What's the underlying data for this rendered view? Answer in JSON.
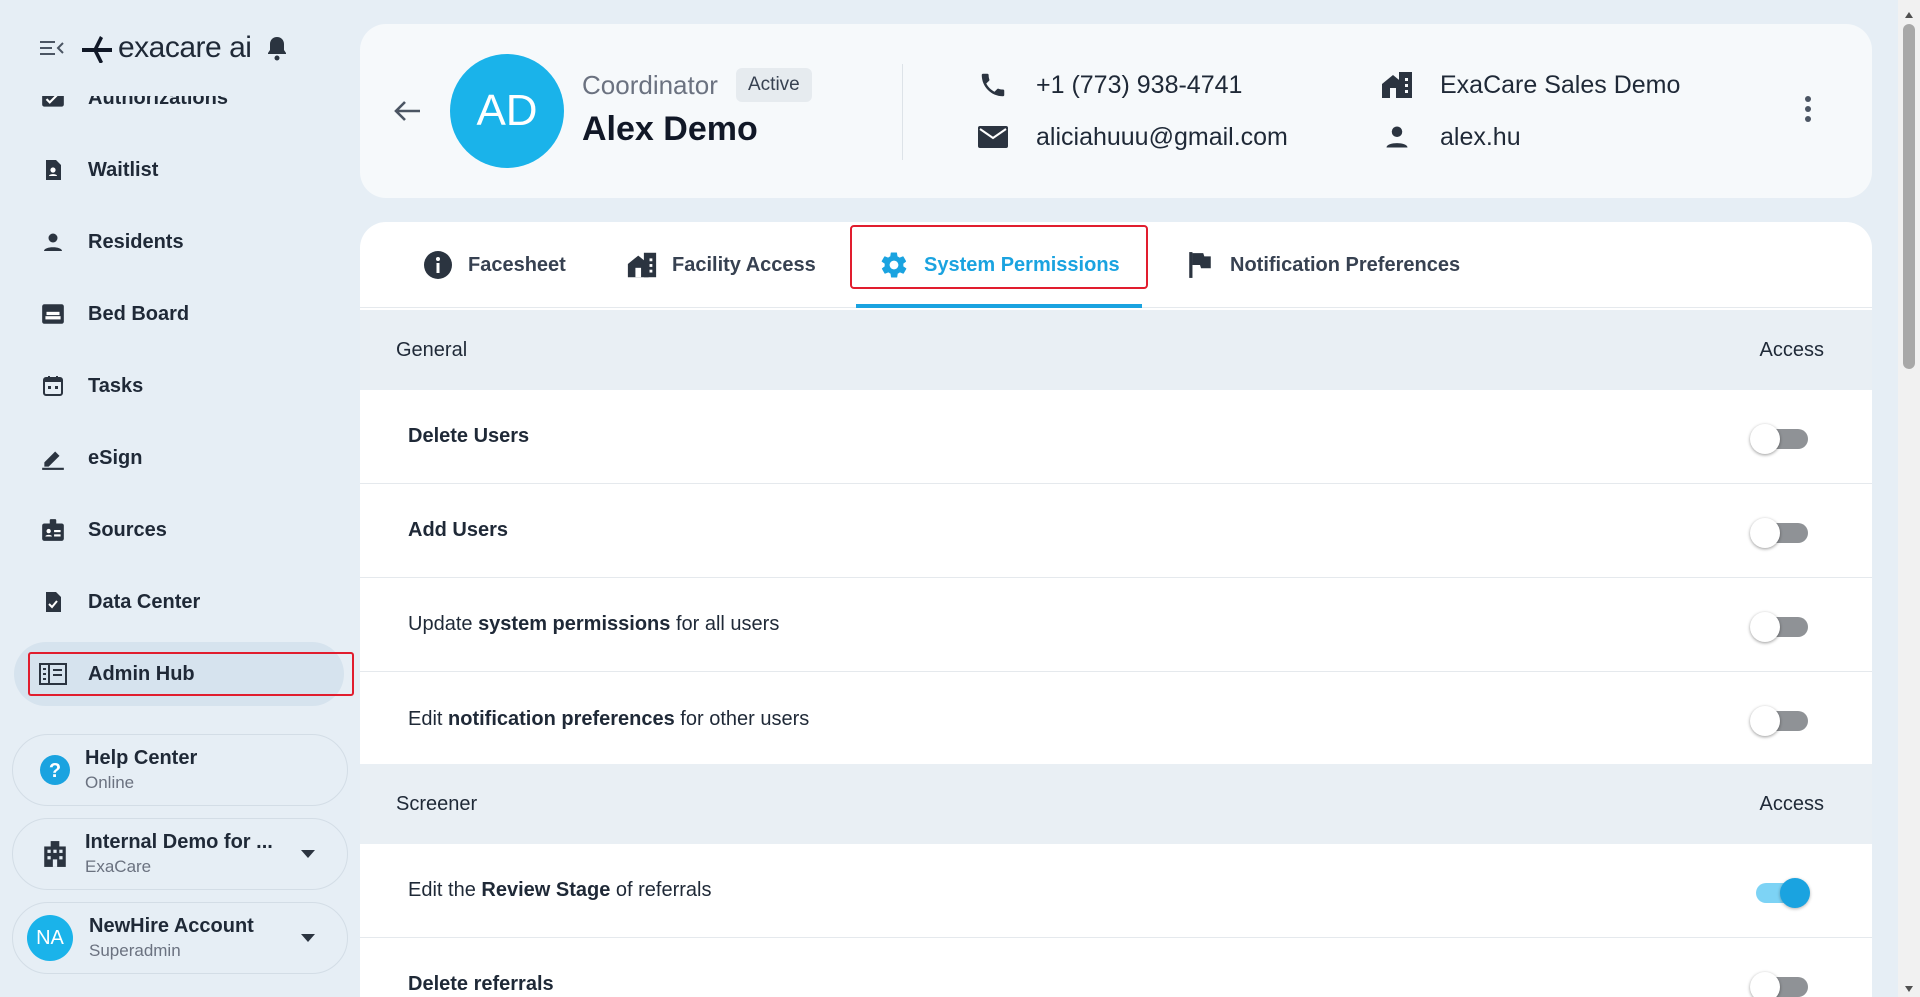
{
  "brand": {
    "logo_text": "exacare ai"
  },
  "sidebar": {
    "items": [
      {
        "label": "Authorizations",
        "icon": "authorizations-icon"
      },
      {
        "label": "Waitlist",
        "icon": "waitlist-icon"
      },
      {
        "label": "Residents",
        "icon": "person-icon"
      },
      {
        "label": "Bed Board",
        "icon": "bed-icon"
      },
      {
        "label": "Tasks",
        "icon": "calendar-icon"
      },
      {
        "label": "eSign",
        "icon": "pen-icon"
      },
      {
        "label": "Sources",
        "icon": "badge-icon"
      },
      {
        "label": "Data Center",
        "icon": "document-check-icon"
      },
      {
        "label": "Admin Hub",
        "icon": "admin-hub-icon"
      }
    ],
    "help": {
      "title": "Help Center",
      "subtitle": "Online"
    },
    "org": {
      "title": "Internal Demo for ...",
      "subtitle": "ExaCare"
    },
    "account": {
      "initials": "NA",
      "title": "NewHire Account",
      "subtitle": "Superadmin"
    }
  },
  "profile": {
    "initials": "AD",
    "role": "Coordinator",
    "status": "Active",
    "name": "Alex Demo",
    "phone": "+1 (773) 938-4741",
    "email": "aliciahuuu@gmail.com",
    "facility": "ExaCare Sales Demo",
    "username": "alex.hu"
  },
  "tabs": [
    {
      "label": "Facesheet"
    },
    {
      "label": "Facility Access"
    },
    {
      "label": "System Permissions"
    },
    {
      "label": "Notification Preferences"
    }
  ],
  "sections": [
    {
      "title": "General",
      "access_label": "Access",
      "rows": [
        {
          "pre": "",
          "bold": "Delete Users",
          "post": "",
          "enabled": false
        },
        {
          "pre": "",
          "bold": "Add Users",
          "post": "",
          "enabled": false
        },
        {
          "pre": "Update ",
          "bold": "system permissions",
          "post": " for all users",
          "enabled": false
        },
        {
          "pre": "Edit ",
          "bold": "notification preferences",
          "post": " for other users",
          "enabled": false
        }
      ]
    },
    {
      "title": "Screener",
      "access_label": "Access",
      "rows": [
        {
          "pre": "Edit the ",
          "bold": "Review Stage",
          "post": " of referrals",
          "enabled": true
        },
        {
          "pre": "",
          "bold": "Delete referrals",
          "post": "",
          "enabled": false
        }
      ]
    }
  ],
  "colors": {
    "accent": "#1aa3e0",
    "avatar": "#1ab3ea",
    "highlight": "#e11d2e"
  }
}
